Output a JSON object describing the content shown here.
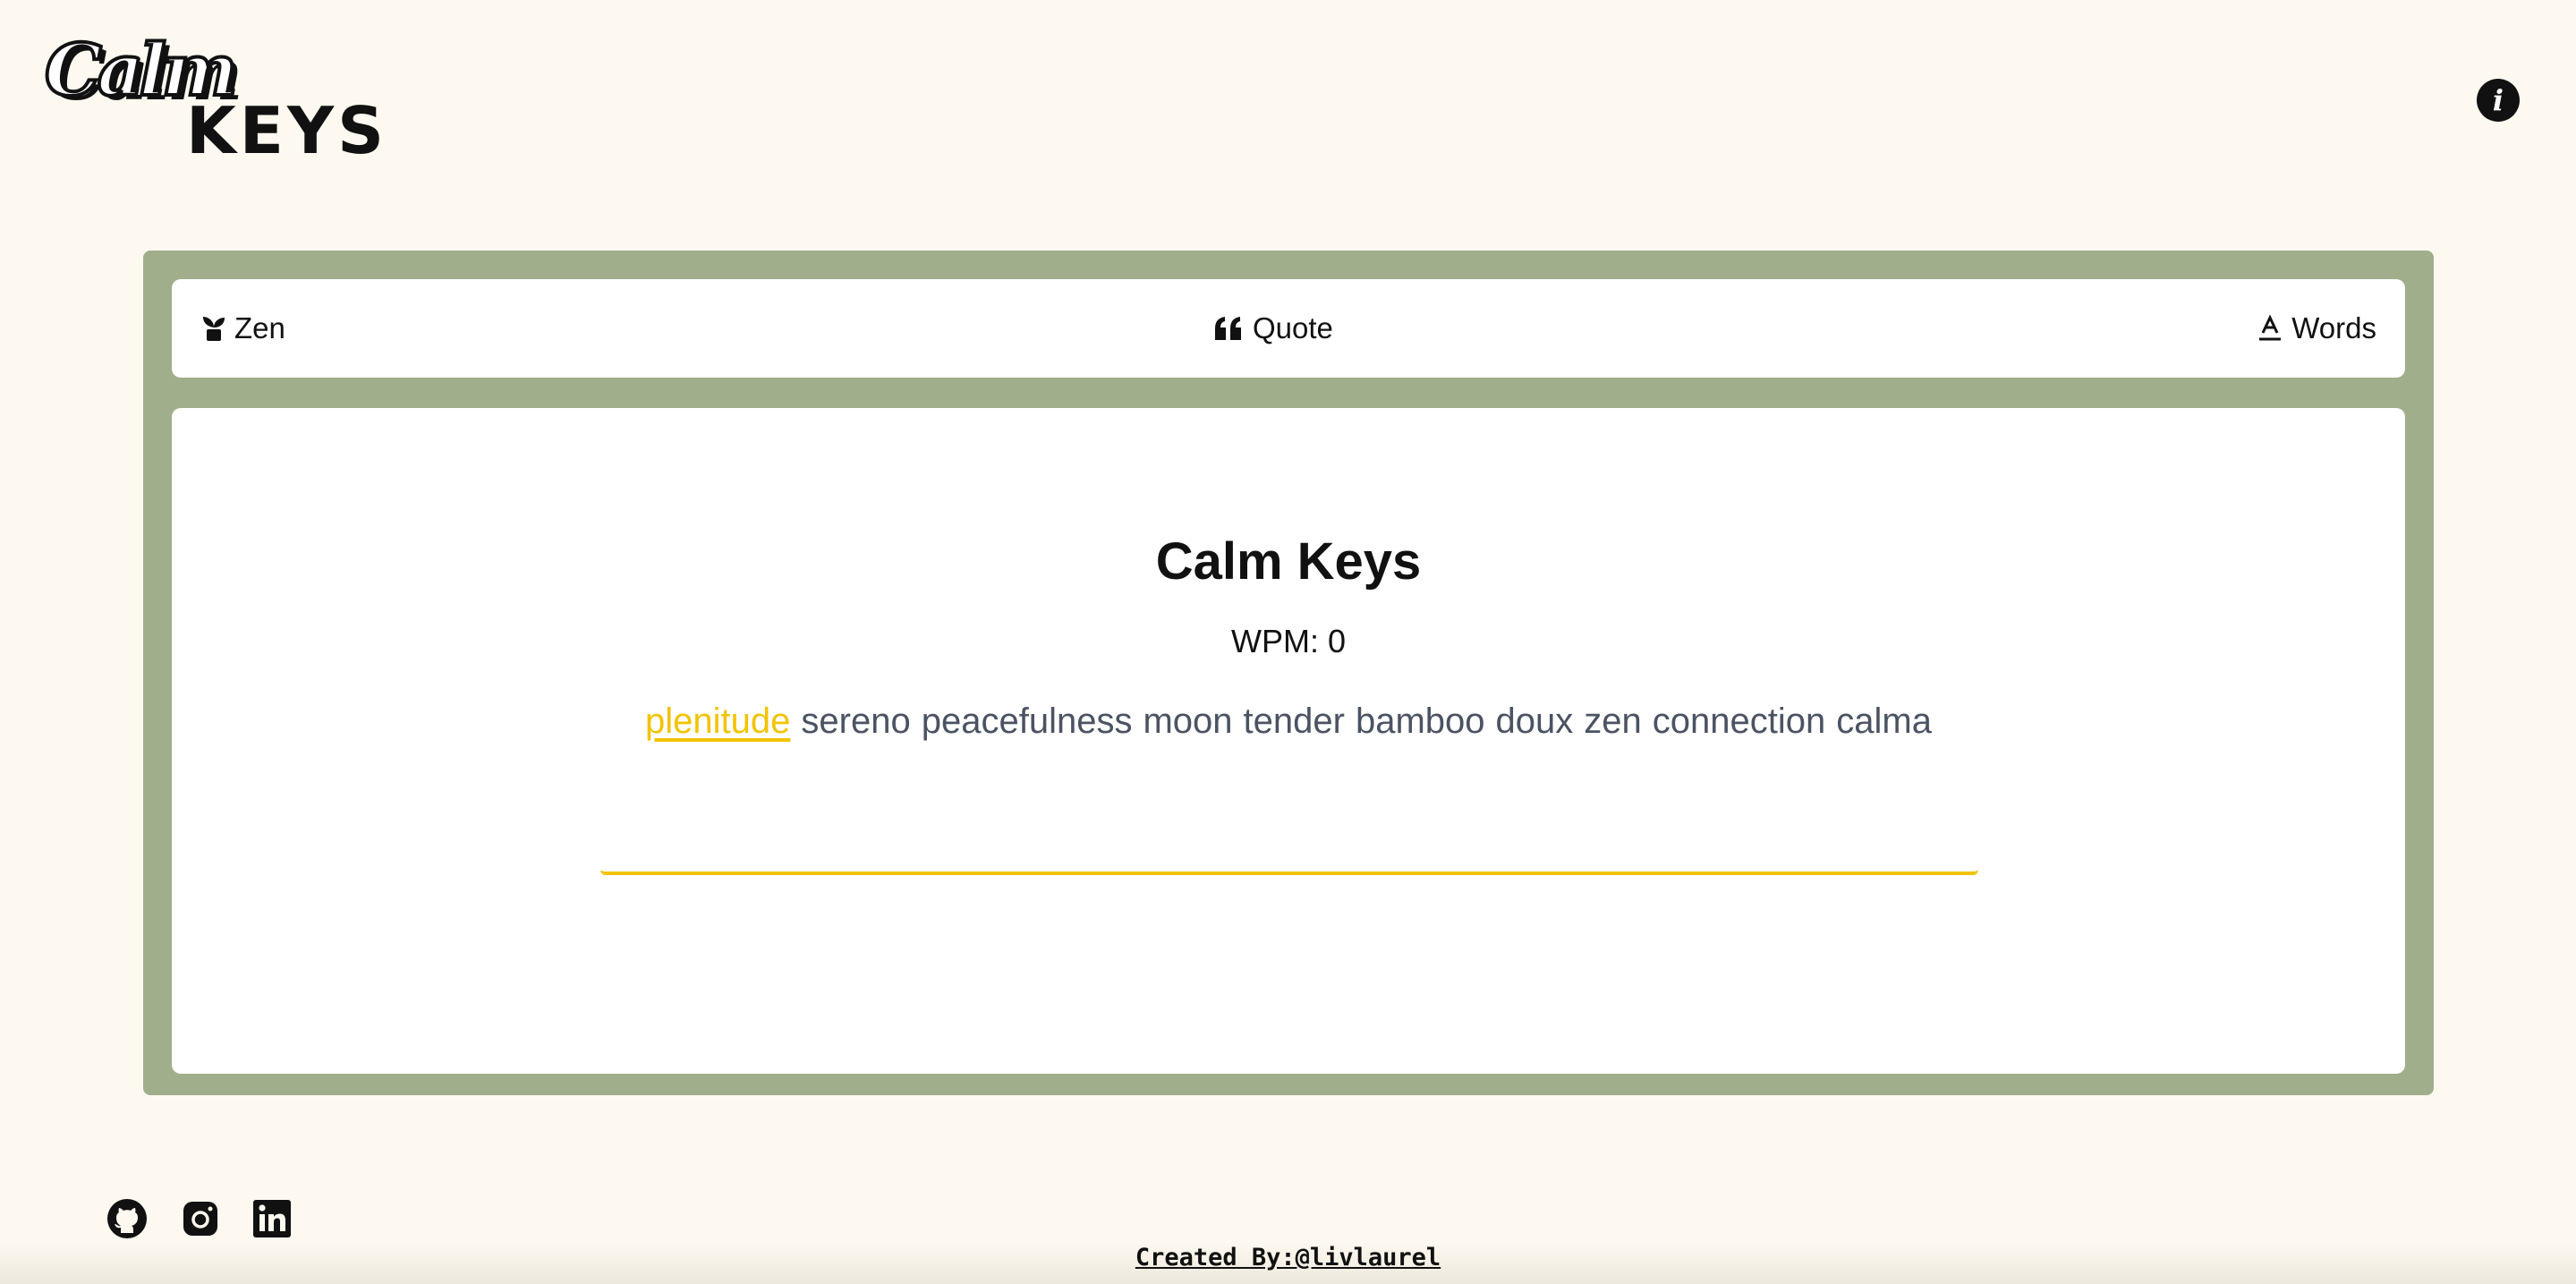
{
  "logo": {
    "line1": "Calm",
    "line2": "KEYS"
  },
  "info_button": {
    "icon": "info-icon",
    "glyph": "i"
  },
  "modes": [
    {
      "label": "Zen",
      "icon": "plant-icon"
    },
    {
      "label": "Quote",
      "icon": "quote-icon"
    },
    {
      "label": "Words",
      "icon": "text-icon"
    }
  ],
  "main": {
    "title": "Calm Keys",
    "wpm_label": "WPM:",
    "wpm_value": "0",
    "words": [
      "plenitude",
      "sereno",
      "peacefulness",
      "moon",
      "tender",
      "bamboo",
      "doux",
      "zen",
      "connection",
      "calma"
    ],
    "active_word_index": 0,
    "input_value": "",
    "input_placeholder": ""
  },
  "social": [
    {
      "name": "github",
      "icon": "github-icon"
    },
    {
      "name": "instagram",
      "icon": "instagram-icon"
    },
    {
      "name": "linkedin",
      "icon": "linkedin-icon"
    }
  ],
  "footer": {
    "credit": "Created By:@livlaurel"
  },
  "colors": {
    "background": "#fdf9f0",
    "frame": "#a0ae8c",
    "accent": "#f2c300",
    "word_text": "#4b5363",
    "text": "#111111"
  }
}
